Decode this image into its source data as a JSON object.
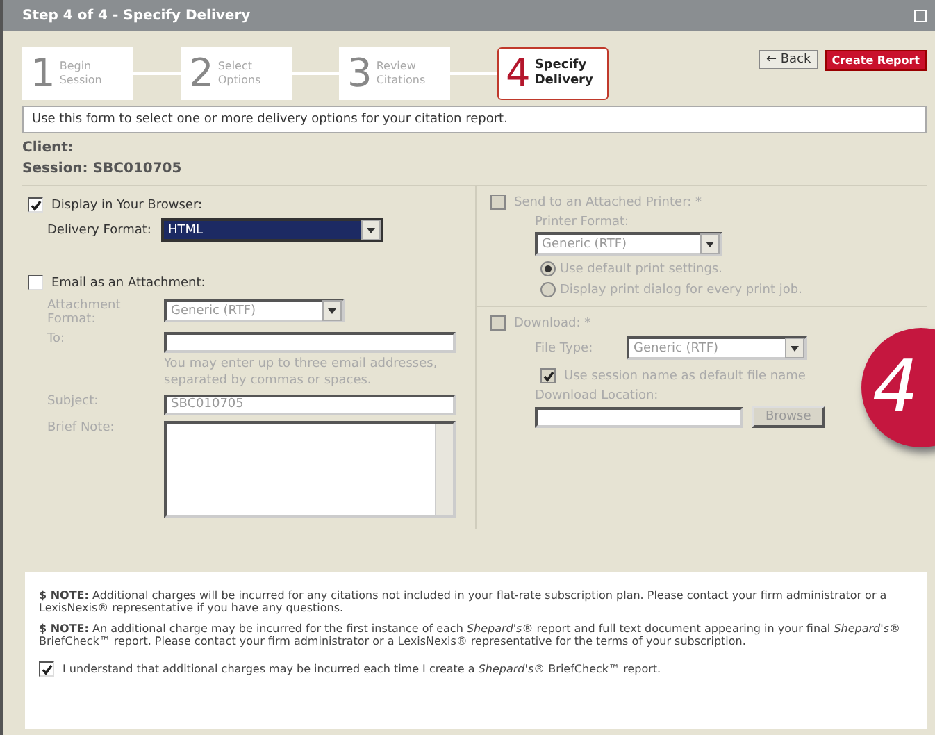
{
  "window": {
    "title": "Step 4 of 4 - Specify Delivery"
  },
  "steps": [
    {
      "number": "1",
      "label": "Begin Session",
      "selected": false
    },
    {
      "number": "2",
      "label": "Select Options",
      "selected": false
    },
    {
      "number": "3",
      "label": "Review Citations",
      "selected": false
    },
    {
      "number": "4",
      "label": "Specify Delivery",
      "selected": true
    }
  ],
  "buttons": {
    "back": "← Back",
    "create": "Create Report"
  },
  "instructions": "Use this form to select one or more delivery options for your citation report.",
  "client_label": "Client:",
  "session": "Session: SBC010705",
  "display": {
    "label": "Display in Your Browser:",
    "checked": true,
    "format_label": "Delivery Format:",
    "format_value": "HTML"
  },
  "email": {
    "label": "Email as an Attachment:",
    "checked": false,
    "disabled": true,
    "format_label": "Attachment Format:",
    "format_value": "Generic (RTF)",
    "to_label": "To:",
    "to_hint": "You may enter up to three email addresses, separated by commas or spaces.",
    "subject_label": "Subject:",
    "subject_value": "SBC010705",
    "note_label": "Brief Note:"
  },
  "printer": {
    "label": "Send to an Attached Printer: *",
    "checked": false,
    "disabled": true,
    "format_label": "Printer Format:",
    "format_value": "Generic (RTF)",
    "options": [
      {
        "label": "Use default print settings.",
        "selected": true
      },
      {
        "label": "Display print dialog for every print job.",
        "selected": false
      }
    ]
  },
  "download": {
    "label": "Download: *",
    "checked": false,
    "disabled": true,
    "filetype_label": "File Type:",
    "filetype_value": "Generic (RTF)",
    "use_session": {
      "label": "Use session name as default file name",
      "checked": true
    },
    "location_label": "Download Location:",
    "browse": "Browse"
  },
  "notes": [
    "**$ NOTE:** Additional charges will be incurred for any citations not included in your flat-rate subscription plan. Please contact your firm administrator or a LexisNexis® representative if you have any questions.",
    "**$ NOTE:** An additional charge may be incurred for the first instance of each *Shepard's®* report and full text document appearing in your final *Shepard's®* BriefCheck™ report. Please contact your firm administrator or a LexisNexis® representative for the terms of your subscription."
  ],
  "agreement": {
    "label": "I understand that additional charges may be incurred each time I create a *Shepard's®* BriefCheck™ report.",
    "checked": true
  },
  "callout": "4"
}
